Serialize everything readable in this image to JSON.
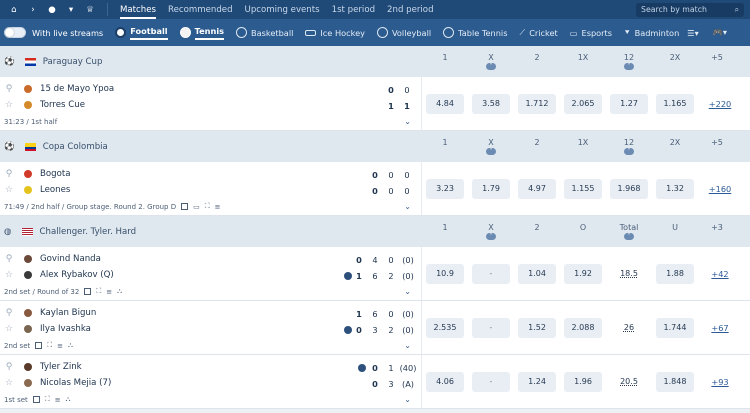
{
  "topnav": {
    "search_placeholder": "Search by match",
    "tabs": [
      "Matches",
      "Recommended",
      "Upcoming events",
      "1st period",
      "2nd period"
    ]
  },
  "sportbar": {
    "live_label": "With live streams",
    "sports": [
      "Football",
      "Tennis",
      "Basketball",
      "Ice Hockey",
      "Volleyball",
      "Table Tennis",
      "Cricket",
      "Esports",
      "Badminton"
    ]
  },
  "leagues": [
    {
      "name": "Paraguay Cup",
      "cols": [
        "1",
        "X",
        "2",
        "1X",
        "12",
        "2X",
        "+5"
      ],
      "matches": [
        {
          "t1": "15 de Mayo Ypoa",
          "t2": "Torres Cue",
          "s1": [
            "0",
            "0"
          ],
          "s2": [
            "1",
            "1"
          ],
          "info": "31:23 / 1st half",
          "odds": [
            "4.84",
            "3.58",
            "1.712",
            "2.065",
            "1.27",
            "1.165"
          ],
          "more": "+220"
        }
      ]
    },
    {
      "name": "Copa Colombia",
      "cols": [
        "1",
        "X",
        "2",
        "1X",
        "12",
        "2X",
        "+5"
      ],
      "matches": [
        {
          "t1": "Bogota",
          "t2": "Leones",
          "s1": [
            "0",
            "0",
            "0"
          ],
          "s2": [
            "0",
            "0",
            "0"
          ],
          "info": "71:49 / 2nd half / Group stage. Round 2. Group D",
          "odds": [
            "3.23",
            "1.79",
            "4.97",
            "1.155",
            "1.968",
            "1.32"
          ],
          "more": "+160"
        }
      ]
    },
    {
      "name": "Challenger. Tyler. Hard",
      "cols": [
        "1",
        "X",
        "2",
        "O",
        "Total",
        "U",
        "+3"
      ],
      "matches": [
        {
          "t1": "Govind Nanda",
          "t2": "Alex Rybakov (Q)",
          "s1": [
            "0",
            "4",
            "0",
            "(0)"
          ],
          "s2": [
            "1",
            "6",
            "2",
            "(0)"
          ],
          "info": "2nd set / Round of 32",
          "odds": [
            "10.9",
            "-",
            "1.04",
            "1.92",
            "18.5",
            "1.88"
          ],
          "more": "+42"
        },
        {
          "t1": "Kaylan Bigun",
          "t2": "Ilya Ivashka",
          "s1": [
            "1",
            "6",
            "0",
            "(0)"
          ],
          "s2": [
            "0",
            "3",
            "2",
            "(0)"
          ],
          "info": "2nd set",
          "odds": [
            "2.535",
            "-",
            "1.52",
            "2.088",
            "26",
            "1.744"
          ],
          "more": "+67"
        },
        {
          "t1": "Tyler Zink",
          "t2": "Nicolas Mejia (7)",
          "s1": [
            "0",
            "1",
            "(40)"
          ],
          "s2": [
            "0",
            "3",
            "(A)"
          ],
          "info": "1st set",
          "odds": [
            "4.06",
            "-",
            "1.24",
            "1.96",
            "20.5",
            "1.848"
          ],
          "more": "+93"
        }
      ]
    }
  ],
  "colors": {
    "topnav": "#1f4977",
    "sportbar": "#2c5b8f",
    "header_bg": "#dfe7ef"
  }
}
